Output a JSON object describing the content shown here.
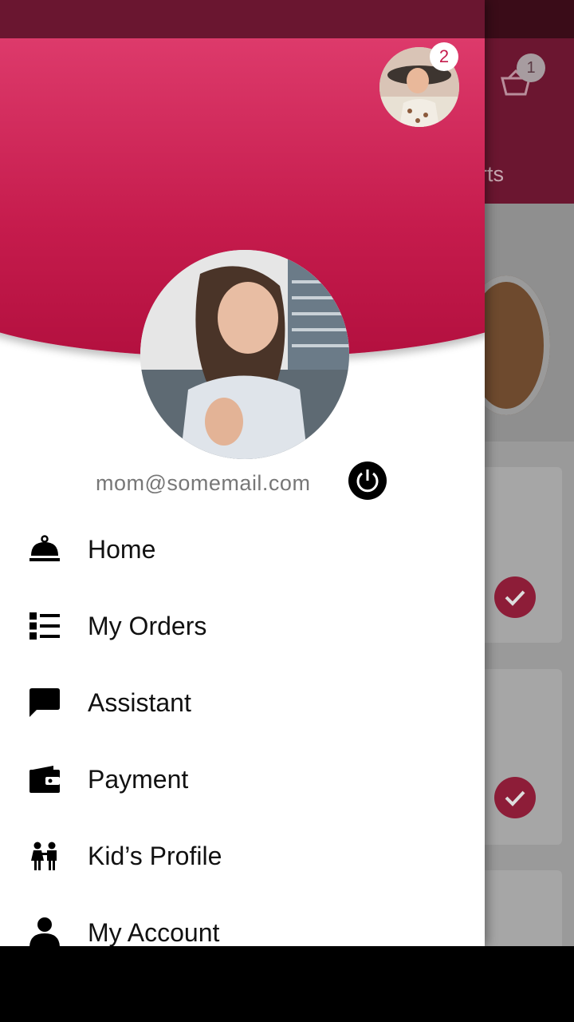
{
  "background": {
    "tab_label": "sserts",
    "cart_count": "1"
  },
  "drawer": {
    "kid_avatar_badge": "2",
    "email": "mom@somemail.com",
    "menu": [
      {
        "label": "Home",
        "icon": "cloche-icon"
      },
      {
        "label": "My Orders",
        "icon": "list-icon"
      },
      {
        "label": "Assistant",
        "icon": "chat-icon"
      },
      {
        "label": "Payment",
        "icon": "wallet-icon"
      },
      {
        "label": "Kid’s Profile",
        "icon": "kids-icon"
      },
      {
        "label": "My Account",
        "icon": "person-icon"
      }
    ]
  },
  "colors": {
    "brand_primary": "#c51b4c",
    "header_gradient_top": "#dd3a6b",
    "status_bar": "#6a1630"
  }
}
